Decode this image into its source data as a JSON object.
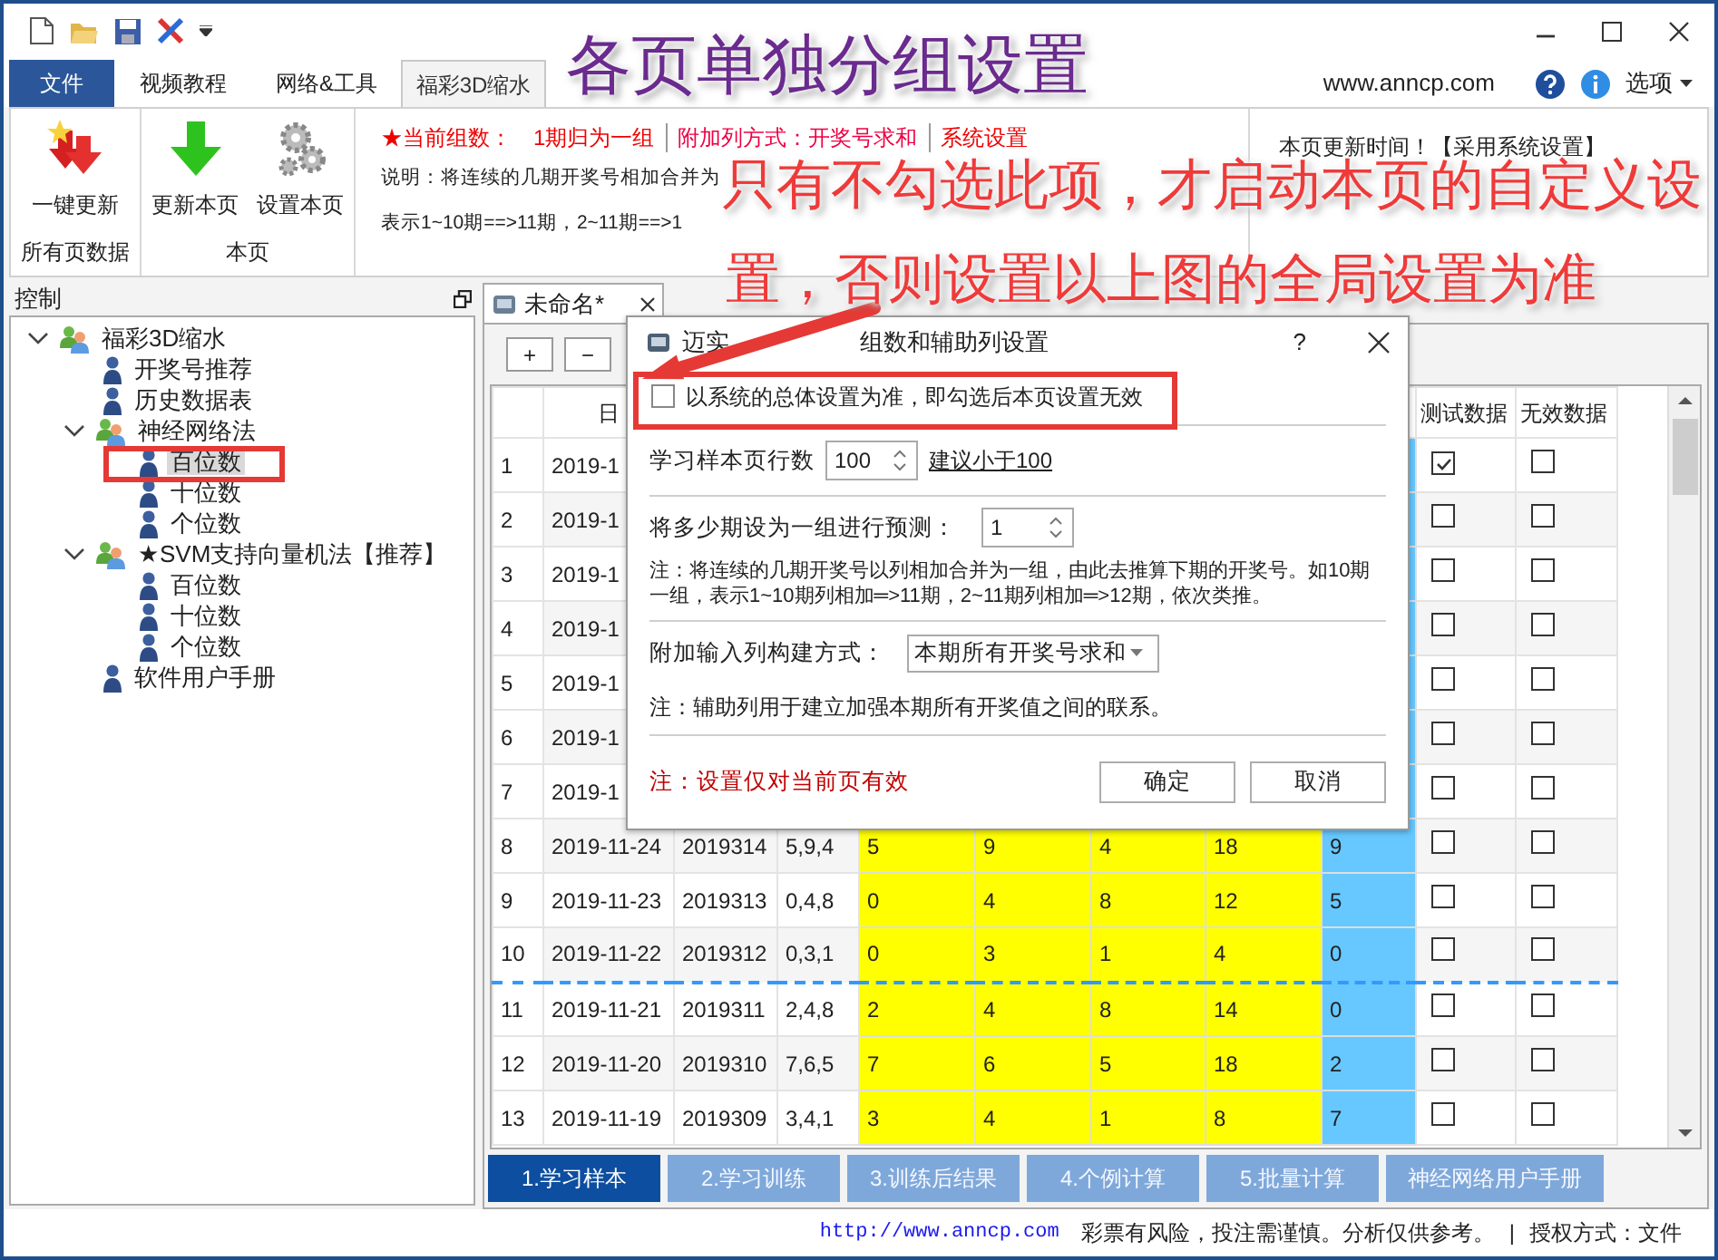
{
  "ribbon_tabs": [
    {
      "label": "文件",
      "kind": "file",
      "selected": false
    },
    {
      "label": "视频教程",
      "kind": "tab",
      "selected": false
    },
    {
      "label": "网络&工具",
      "kind": "tab",
      "selected": false
    },
    {
      "label": "福彩3D缩水",
      "kind": "tab",
      "selected": true
    }
  ],
  "website": "www.anncp.com",
  "options_menu": "选项",
  "ribbon_groups": [
    {
      "label": "所有页数据",
      "buttons": [
        {
          "label": "一键更新",
          "kind": "update_all"
        }
      ]
    },
    {
      "label": "本页",
      "buttons": [
        {
          "label": "更新本页",
          "kind": "update"
        },
        {
          "label": "设置本页",
          "kind": "settings"
        }
      ]
    }
  ],
  "settings_panel": {
    "group_count_label": "★当前组数：",
    "group_count": "1期归为一组",
    "extra_column": "附加列方式：开奖号求和",
    "system_settings": "系统设置",
    "description_lines": [
      "说明：将连续的几期开奖号相加合并为",
      "表示1~10期==>11期，2~11期==>1"
    ]
  },
  "update_time": "本页更新时间！【采用系统设置】",
  "tree_panel": {
    "title": "控制",
    "items": [
      {
        "label": "福彩3D缩水",
        "kind": "group",
        "expanded": true,
        "selected": false,
        "children": [
          {
            "label": "开奖号推荐",
            "kind": "leaf",
            "selected": false
          },
          {
            "label": "历史数据表",
            "kind": "leaf",
            "selected": false
          },
          {
            "label": "神经网络法",
            "kind": "group",
            "expanded": true,
            "selected": false,
            "children": [
              {
                "label": "百位数",
                "kind": "leaf",
                "selected": true
              },
              {
                "label": "十位数",
                "kind": "leaf",
                "selected": false
              },
              {
                "label": "个位数",
                "kind": "leaf",
                "selected": false
              }
            ]
          },
          {
            "label": "★SVM支持向量机法【推荐】",
            "kind": "group",
            "expanded": true,
            "selected": false,
            "children": [
              {
                "label": "百位数",
                "kind": "leaf",
                "selected": false
              },
              {
                "label": "十位数",
                "kind": "leaf",
                "selected": false
              },
              {
                "label": "个位数",
                "kind": "leaf",
                "selected": false
              }
            ]
          },
          {
            "label": "软件用户手册",
            "kind": "leaf",
            "selected": false
          }
        ]
      }
    ]
  },
  "document_tab": {
    "label": "未命名*"
  },
  "toolbar_buttons": [
    "+",
    "−"
  ],
  "table": {
    "headers": {
      "date": "日",
      "test": "测试数据",
      "invalid": "无效数据"
    },
    "rows": [
      {
        "no": "1",
        "date": "2019-1",
        "test": true,
        "invalid": false,
        "separator_below": false
      },
      {
        "no": "2",
        "date": "2019-1",
        "test": false,
        "invalid": false,
        "separator_below": false
      },
      {
        "no": "3",
        "date": "2019-1",
        "test": false,
        "invalid": false,
        "separator_below": false
      },
      {
        "no": "4",
        "date": "2019-1",
        "test": false,
        "invalid": false,
        "separator_below": false
      },
      {
        "no": "5",
        "date": "2019-1",
        "test": false,
        "invalid": false,
        "separator_below": false
      },
      {
        "no": "6",
        "date": "2019-1",
        "test": false,
        "invalid": false,
        "separator_below": false
      },
      {
        "no": "7",
        "date": "2019-1",
        "test": false,
        "invalid": false,
        "separator_below": false
      },
      {
        "no": "8",
        "date": "2019-11-24",
        "issue": "2019314",
        "numbers": "5,9,4",
        "values": [
          "5",
          "9",
          "4",
          "18"
        ],
        "aux": "9",
        "test": false,
        "invalid": false,
        "separator_below": false
      },
      {
        "no": "9",
        "date": "2019-11-23",
        "issue": "2019313",
        "numbers": "0,4,8",
        "values": [
          "0",
          "4",
          "8",
          "12"
        ],
        "aux": "5",
        "test": false,
        "invalid": false,
        "separator_below": false
      },
      {
        "no": "10",
        "date": "2019-11-22",
        "issue": "2019312",
        "numbers": "0,3,1",
        "values": [
          "0",
          "3",
          "1",
          "4"
        ],
        "aux": "0",
        "test": false,
        "invalid": false,
        "separator_below": true
      },
      {
        "no": "11",
        "date": "2019-11-21",
        "issue": "2019311",
        "numbers": "2,4,8",
        "values": [
          "2",
          "4",
          "8",
          "14"
        ],
        "aux": "0",
        "test": false,
        "invalid": false,
        "separator_below": false
      },
      {
        "no": "12",
        "date": "2019-11-20",
        "issue": "2019310",
        "numbers": "7,6,5",
        "values": [
          "7",
          "6",
          "5",
          "18"
        ],
        "aux": "2",
        "test": false,
        "invalid": false,
        "separator_below": false
      },
      {
        "no": "13",
        "date": "2019-11-19",
        "issue": "2019309",
        "numbers": "3,4,1",
        "values": [
          "3",
          "4",
          "1",
          "8"
        ],
        "aux": "7",
        "test": false,
        "invalid": false,
        "separator_below": false
      }
    ]
  },
  "bottom_tabs": [
    {
      "label": "1.学习样本",
      "selected": true
    },
    {
      "label": "2.学习训练",
      "selected": false
    },
    {
      "label": "3.训练后结果",
      "selected": false
    },
    {
      "label": "4.个例计算",
      "selected": false
    },
    {
      "label": "5.批量计算",
      "selected": false
    },
    {
      "label": "神经网络用户手册",
      "selected": false
    }
  ],
  "status_bar": {
    "link": "http://www.anncp.com",
    "notice": "彩票有风险，投注需谨慎。分析仅供参考。",
    "separator": "|",
    "license": "授权方式：文件"
  },
  "dialog": {
    "title_parts": [
      "迈实",
      "组数和辅助列设置"
    ],
    "help": "?",
    "use_global": {
      "label": "以系统的总体设置为准，即勾选后本页设置无效",
      "checked": false
    },
    "rows_label": "学习样本页行数",
    "rows_value": "100",
    "rows_hint": "建议小于100",
    "group_label": "将多少期设为一组进行预测：",
    "group_value": "1",
    "group_note": "注：将连续的几期开奖号以列相加合并为一组，由此去推算下期的开奖号。如10期一组，表示1~10期列相加═>11期，2~11期列相加═>12期，依次类推。",
    "extra_label": "附加输入列构建方式：",
    "extra_value": "本期所有开奖号求和",
    "extra_note": "注：辅助列用于建立加强本期所有开奖值之间的联系。",
    "scope_note": "注：设置仅对当前页有效",
    "buttons": [
      "确定",
      "取消"
    ]
  },
  "annotations": {
    "heading": "各页单独分组设置",
    "callout_lines": [
      "只有不勾选此项，才启动本页的自定义设",
      "置，否则设置以上图的全局设置为准"
    ]
  }
}
